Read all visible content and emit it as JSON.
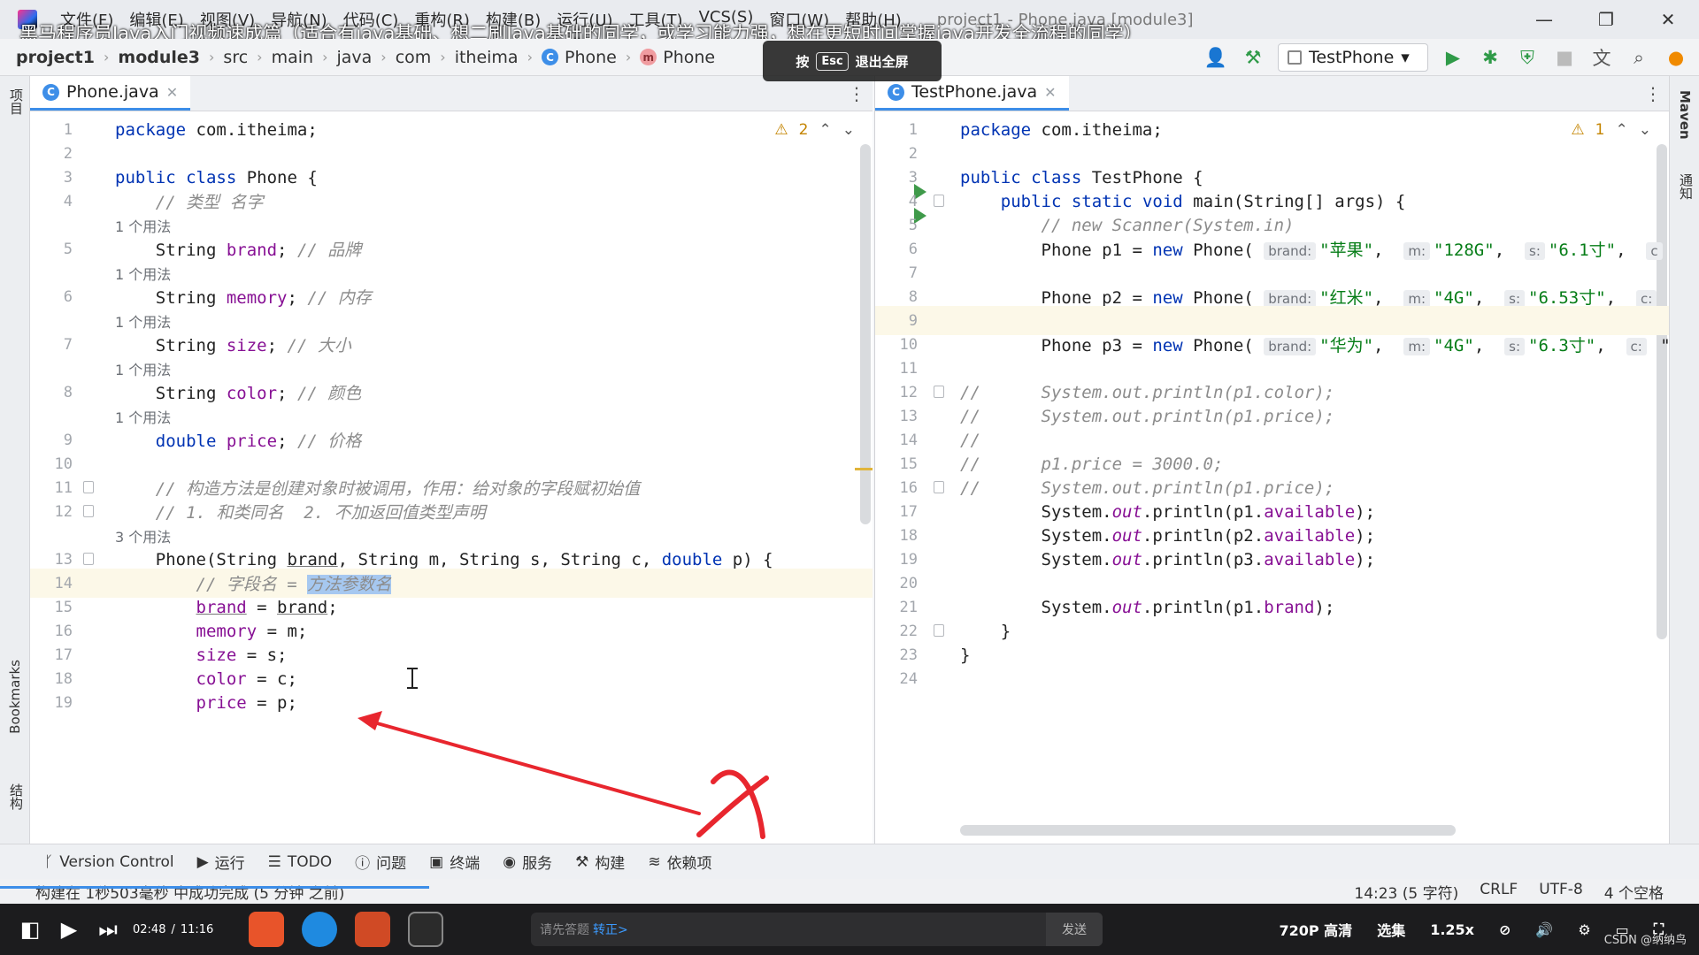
{
  "menubar": {
    "items": [
      "文件(F)",
      "编辑(E)",
      "视图(V)",
      "导航(N)",
      "代码(C)",
      "重构(R)",
      "构建(B)",
      "运行(U)",
      "工具(T)",
      "VCS(S)",
      "窗口(W)",
      "帮助(H)"
    ],
    "window_title": "project1 - Phone.java [module3]"
  },
  "video_title": "黑马程序员Java入门视频速成篇（适合有java基础、想二刷Java基础的同学，或学习能力强，想在更短时间掌握java开发全流程的同学）",
  "esc_hint": {
    "prefix": "按",
    "key": "Esc",
    "suffix": "退出全屏"
  },
  "breadcrumb": [
    "project1",
    "module3",
    "src",
    "main",
    "java",
    "com",
    "itheima",
    "Phone",
    "Phone"
  ],
  "run_config": "TestPhone",
  "left_editor": {
    "tab": "Phone.java",
    "warnings": "2",
    "lines": [
      {
        "n": "1"
      },
      {
        "n": "2"
      },
      {
        "n": "3"
      },
      {
        "n": "4"
      },
      {
        "hint": "1 个用法"
      },
      {
        "n": "5"
      },
      {
        "hint": "1 个用法"
      },
      {
        "n": "6"
      },
      {
        "hint": "1 个用法"
      },
      {
        "n": "7"
      },
      {
        "hint": "1 个用法"
      },
      {
        "n": "8"
      },
      {
        "hint": "1 个用法"
      },
      {
        "n": "9"
      },
      {
        "n": "10"
      },
      {
        "n": "11"
      },
      {
        "n": "12"
      },
      {
        "hint": "3 个用法"
      },
      {
        "n": "13"
      },
      {
        "n": "14"
      },
      {
        "n": "15"
      },
      {
        "n": "16"
      },
      {
        "n": "17"
      },
      {
        "n": "18"
      },
      {
        "n": "19"
      }
    ]
  },
  "right_editor": {
    "tab": "TestPhone.java",
    "warnings": "1",
    "lines": [
      "1",
      "2",
      "3",
      "4",
      "5",
      "6",
      "7",
      "8",
      "9",
      "10",
      "11",
      "12",
      "13",
      "14",
      "15",
      "16",
      "17",
      "18",
      "19",
      "20",
      "21",
      "22",
      "23",
      "24"
    ]
  },
  "bottom_tools": [
    "Version Control",
    "运行",
    "TODO",
    "问题",
    "终端",
    "服务",
    "构建",
    "依赖项"
  ],
  "status": {
    "message": "构建在 1秒503毫秒 中成功完成 (5 分钟 之前)",
    "position": "14:23 (5 字符)",
    "line_sep": "CRLF",
    "encoding": "UTF-8",
    "indent": "4 个空格"
  },
  "player": {
    "current_time": "02:48",
    "total_time": "11:16",
    "danmaku_placeholder": "请先答题",
    "danmaku_link": "转正>",
    "send": "发送",
    "quality": "720P 高清",
    "episodes": "选集",
    "speed": "1.25x"
  },
  "watermark": "CSDN @纳纳鸟",
  "colors": {
    "keyword": "#0033b3",
    "field": "#871094",
    "string": "#067d17",
    "comment": "#8c8c8c",
    "selection": "#a6c8f0",
    "annotation": "#e8262e"
  }
}
